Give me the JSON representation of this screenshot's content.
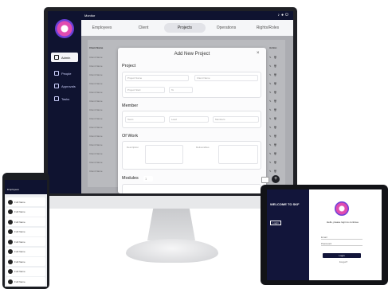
{
  "monitor": {
    "app_name": "Monitor",
    "topbar_icons": [
      "bell-icon",
      "user-icon",
      "logout-icon"
    ],
    "sidebar": [
      {
        "label": "Admin",
        "icon": "admin-icon",
        "active": true
      },
      {
        "label": "People",
        "icon": "people-icon",
        "active": false
      },
      {
        "label": "Approvals",
        "icon": "approvals-icon",
        "active": false
      },
      {
        "label": "Tasks",
        "icon": "pin-icon",
        "active": false
      }
    ],
    "tabs": [
      "Employees",
      "Client",
      "Projects",
      "Operations",
      "Rights/Roles"
    ],
    "active_tab": "Projects",
    "table": {
      "header_left": "Client Name",
      "header_right": "Action",
      "rows_left": [
        "Client Name",
        "Client Name",
        "Client Name",
        "Client Name",
        "Client Name",
        "Client Name",
        "Client Name",
        "Client Name",
        "Client Name",
        "Client Name",
        "Client Name",
        "Client Name",
        "Client Name",
        "Client Name"
      ]
    },
    "modal": {
      "title": "Add New Project",
      "close": "×",
      "project_heading": "Project",
      "project_fields": [
        "Project Name",
        "Client Name",
        "Project Start",
        "To"
      ],
      "member_heading": "Member",
      "member_fields": [
        "Team",
        "Lead",
        "Members"
      ],
      "of_work_heading": "Of Work",
      "of_work_fields": [
        "Description",
        "Deliverables"
      ],
      "modules_heading": "Modules",
      "modules_field": "1"
    },
    "fab": "+",
    "accent": "#0f1330",
    "brand_gradient": [
      "#e04cb0",
      "#6a3fd8"
    ]
  },
  "phone": {
    "header_title": "Employees",
    "items": [
      "Full Name",
      "Full Name",
      "Full Name",
      "Full Name",
      "Full Name",
      "Full Name",
      "Full Name",
      "Full Name",
      "Full Name",
      "Full Name"
    ]
  },
  "tablet": {
    "welcome": "WELCOME TO SKF",
    "sub": "Login",
    "prompt": "Hello, please login to continue",
    "field_email": "Email",
    "field_password": "Password",
    "login_button": "Login",
    "forgot": "Forgot?"
  }
}
